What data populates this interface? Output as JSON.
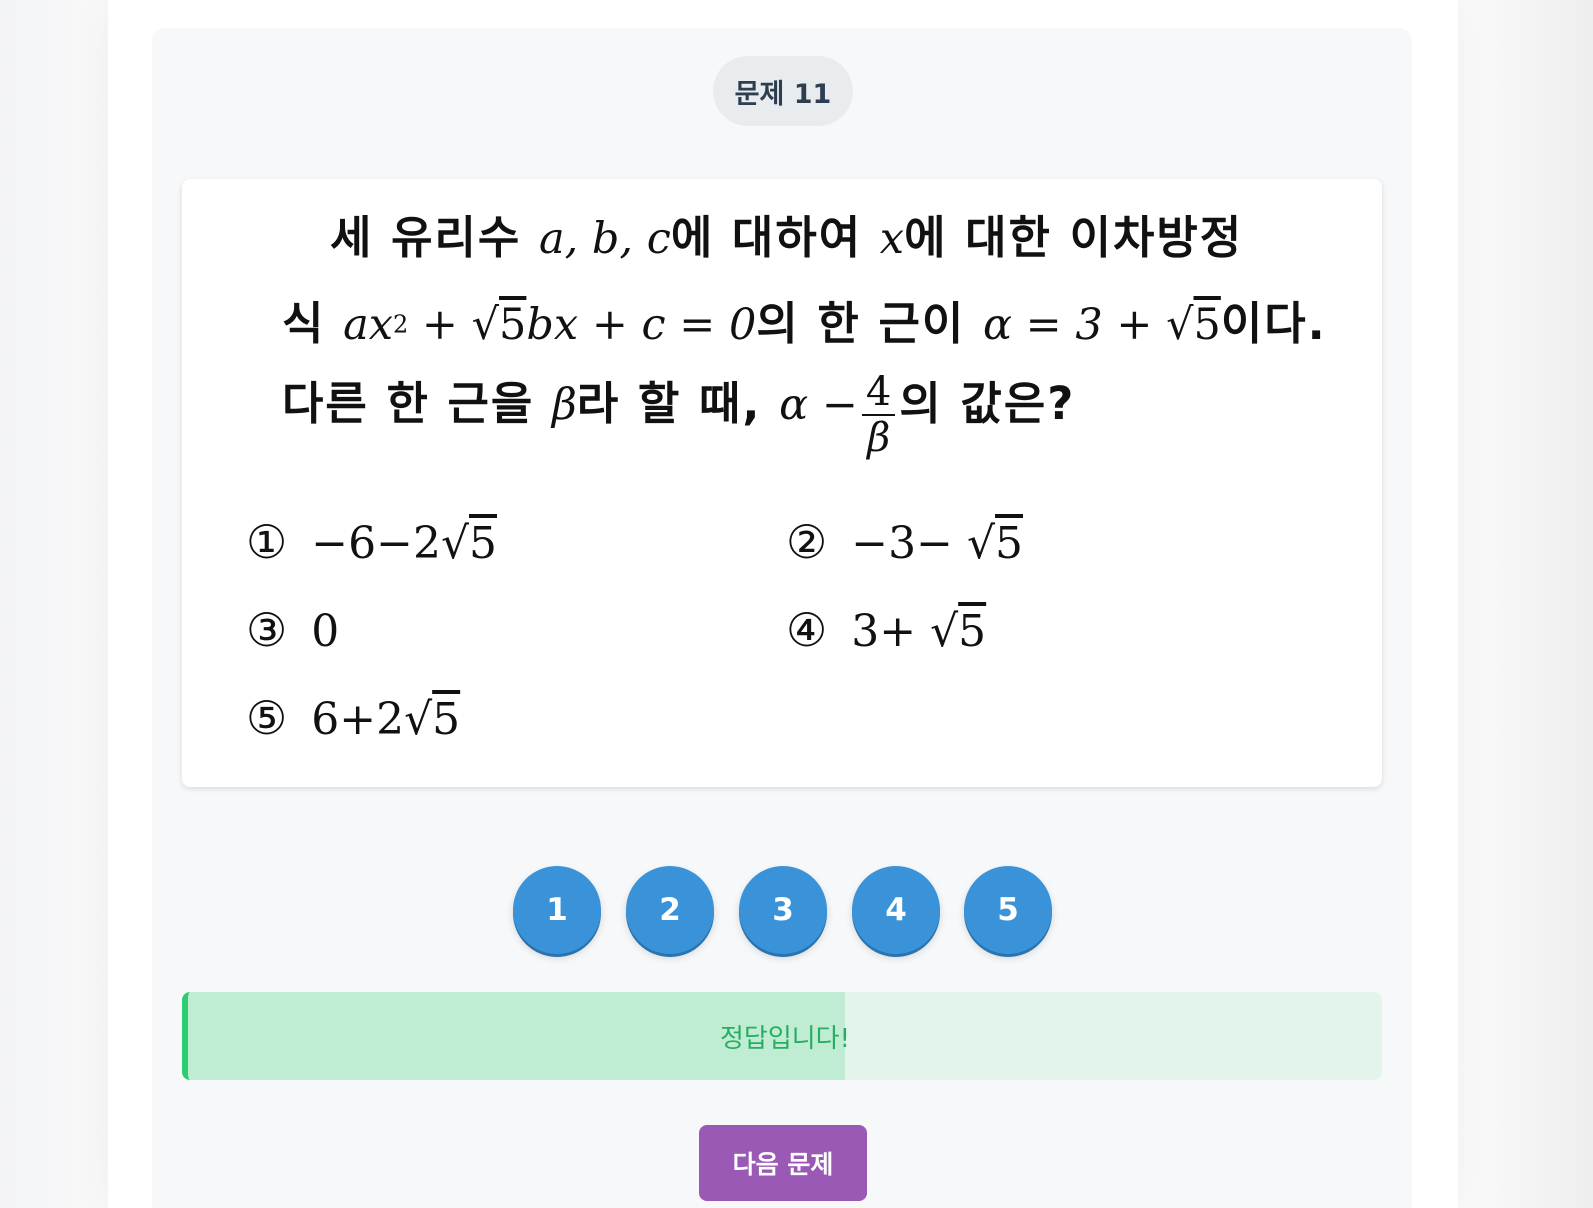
{
  "question": {
    "badge": "문제 11",
    "line1": {
      "pre": "세 유리수 ",
      "vars": "a, b, c",
      "mid": "에 대하여 ",
      "x": "x",
      "post": "에 대한 이차방정"
    },
    "line2": {
      "pre": "식 ",
      "eq_a": "ax",
      "eq_sup": "2",
      "eq_mid": " + √",
      "eq_rad": "5",
      "eq_bx": "bx",
      "eq_tail": " + c = 0",
      "mid": "의 한 근이 ",
      "alpha_eq": "α = 3 + √",
      "alpha_rad": "5",
      "post": "이다."
    },
    "line3": {
      "pre": "다른 한 근을 ",
      "beta": "β",
      "mid": "라 할 때, ",
      "expr": "α −",
      "frac_num": "4",
      "frac_den": "β",
      "post": "의 값은?"
    }
  },
  "choices": [
    {
      "num": "①",
      "text": "−6−2√",
      "rad": "5"
    },
    {
      "num": "②",
      "text": "−3− √",
      "rad": "5"
    },
    {
      "num": "③",
      "text": "0",
      "rad": ""
    },
    {
      "num": "④",
      "text": "3+ √",
      "rad": "5"
    },
    {
      "num": "⑤",
      "text": "6+2√",
      "rad": "5"
    }
  ],
  "answer_buttons": [
    "1",
    "2",
    "3",
    "4",
    "5"
  ],
  "feedback": {
    "text": "정답입니다!",
    "progress": 0.55,
    "accent_color": "#2ecc71"
  },
  "next_button": {
    "label": "다음 문제",
    "color": "#9b59b6"
  },
  "colors": {
    "answer_button": "#3a93d8"
  }
}
